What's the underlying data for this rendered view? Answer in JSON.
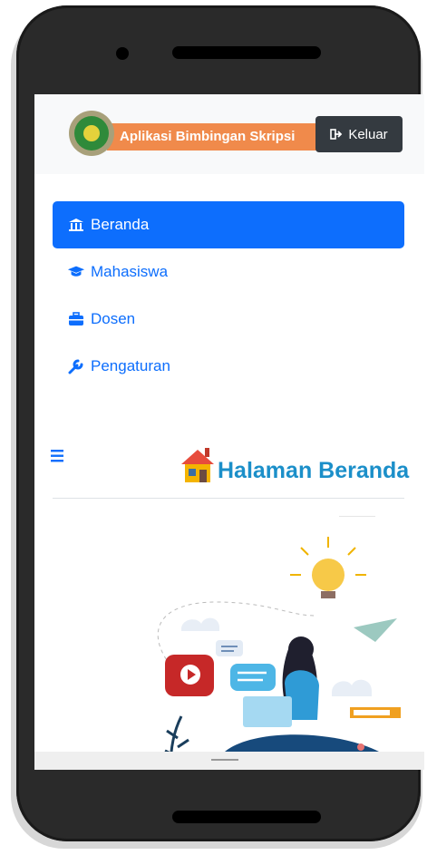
{
  "header": {
    "app_title": "Aplikasi Bimbingan Skripsi",
    "logout_label": "Keluar"
  },
  "sidebar": {
    "items": [
      {
        "label": "Beranda",
        "icon": "bank-icon",
        "active": true
      },
      {
        "label": "Mahasiswa",
        "icon": "graduation-cap-icon",
        "active": false
      },
      {
        "label": "Dosen",
        "icon": "briefcase-icon",
        "active": false
      },
      {
        "label": "Pengaturan",
        "icon": "wrench-icon",
        "active": false
      }
    ]
  },
  "main": {
    "page_title": "Halaman Beranda",
    "title_icon": "house-icon",
    "menu_icon": "hamburger-menu-icon"
  },
  "colors": {
    "primary": "#0d6efd",
    "brand_orange": "#f08a4b",
    "title_blue": "#1b8fc9",
    "dark_button": "#343a40"
  }
}
